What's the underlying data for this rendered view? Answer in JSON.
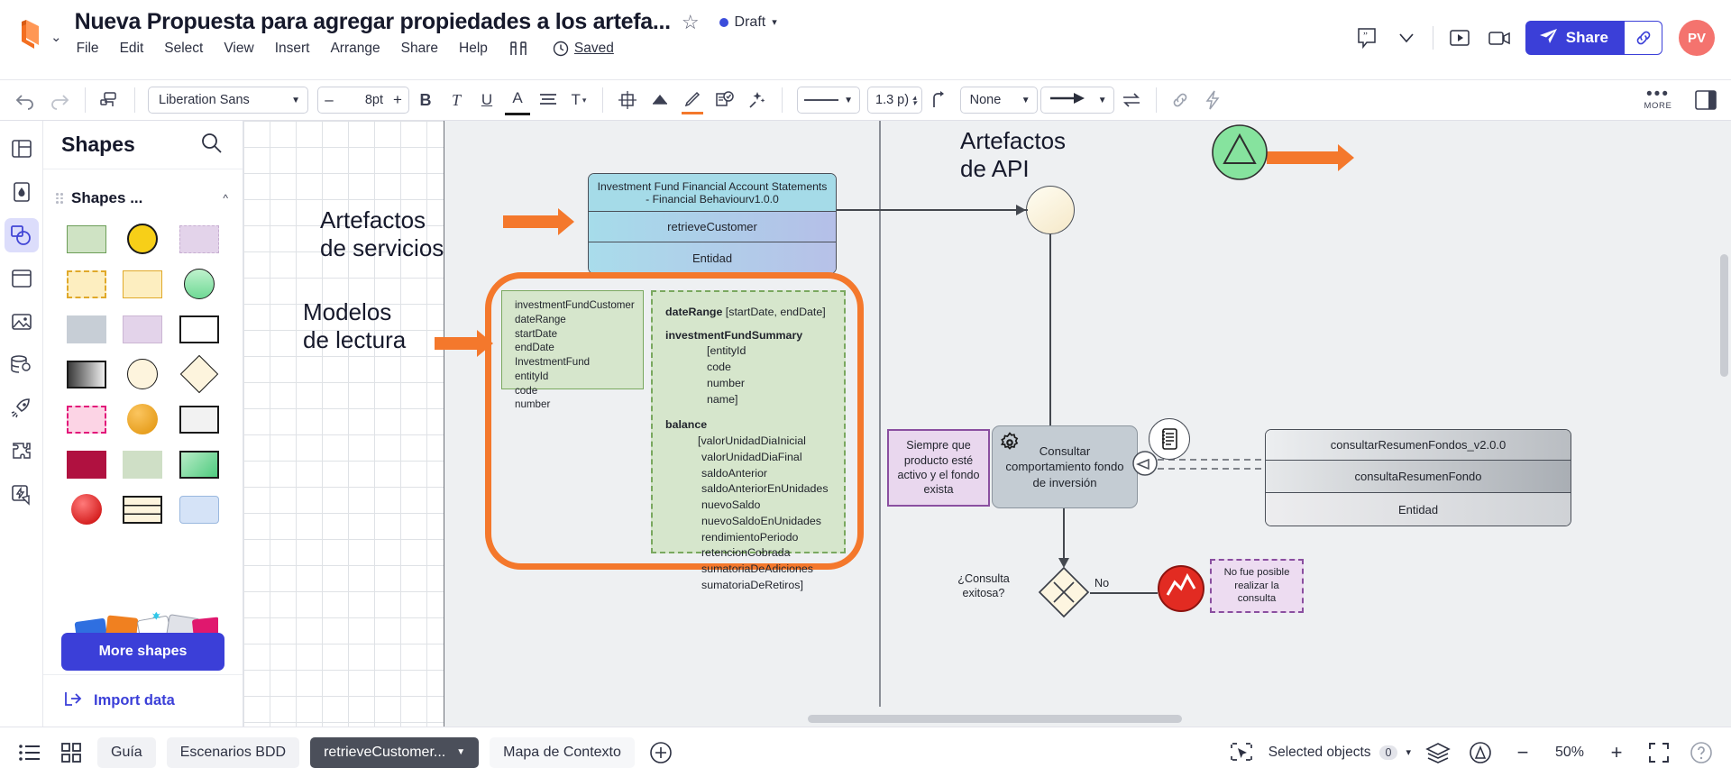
{
  "header": {
    "doc_title": "Nueva Propuesta para agregar propiedades a los artefa...",
    "star_icon": "star-outline-icon",
    "status_dot_color": "#3b4ddb",
    "status_label": "Draft",
    "status_caret": "▾",
    "menu": [
      "File",
      "Edit",
      "Select",
      "View",
      "Insert",
      "Arrange",
      "Share",
      "Help"
    ],
    "menu_extra_icon": "shapes-library-icon",
    "history_icon": "clock-icon",
    "saved_label": "Saved",
    "comment_icon": "comment-quote-icon",
    "chevron_icon": "chevron-down-icon",
    "present_icon": "present-icon",
    "video_icon": "video-camera-icon",
    "share_label": "Share",
    "share_icon": "paper-plane-icon",
    "link_icon": "link-icon",
    "avatar_initials": "PV",
    "avatar_color": "#f4736e",
    "accent_color": "#3b3fd8"
  },
  "toolbar": {
    "undo_icon": "undo-icon",
    "redo_icon": "redo-icon",
    "format_painter_icon": "format-painter-icon",
    "font_family": "Liberation Sans",
    "font_caret": "▼",
    "decrease_label": "–",
    "font_size": "8pt",
    "increase_label": "+",
    "bold_label": "B",
    "italic_label": "T",
    "underline_label": "U",
    "text_color_label": "A",
    "align_icon": "align-icon",
    "text_options_label": "T",
    "distribute_icon": "distribute-icon",
    "fill_icon": "fill-bucket-icon",
    "line-color_icon": "pen-icon",
    "notes_icon": "note-check-icon",
    "magic_icon": "magic-wand-icon",
    "line_style_caret": "▼",
    "line_weight": "1.3 p)",
    "connector_icon": "elbow-connector-icon",
    "line_start": "None",
    "line_start_caret": "▼",
    "line_end_icon": "arrow-end-icon",
    "line_end_caret": "▼",
    "swap_icon": "swap-ends-icon",
    "link_icon": "link-icon",
    "lightning_icon": "lightning-icon",
    "more_label": "MORE",
    "panel_toggle_icon": "right-panel-icon"
  },
  "rail": {
    "items": [
      {
        "name": "templates-icon",
        "active": false
      },
      {
        "name": "theme-icon",
        "active": false
      },
      {
        "name": "shapes-icon",
        "active": true
      },
      {
        "name": "frames-icon",
        "active": false
      },
      {
        "name": "image-icon",
        "active": false
      },
      {
        "name": "data-icon",
        "active": false
      },
      {
        "name": "rocket-icon",
        "active": false
      },
      {
        "name": "plugins-icon",
        "active": false
      },
      {
        "name": "automation-icon",
        "active": false
      }
    ]
  },
  "shapes_panel": {
    "title": "Shapes",
    "search_icon": "search-icon",
    "section_title": "Shapes ...",
    "collapse_caret": "^",
    "more_shapes_label": "More shapes",
    "import_label": "Import data",
    "import_icon": "import-icon",
    "swatches": [
      {
        "shape": "rect",
        "fill": "#cfe3c4",
        "stroke": "#6c9e58",
        "dashed": false
      },
      {
        "shape": "circle",
        "fill": "#f7cf18",
        "stroke": "#1a1a1a",
        "dashed": false
      },
      {
        "shape": "rect",
        "fill": "#e3d3ea",
        "stroke": "#c6aed1",
        "dashed": true
      },
      {
        "shape": "rect",
        "fill": "#fdeec0",
        "stroke": "#e0a92a",
        "dashed": true
      },
      {
        "shape": "rect",
        "fill": "#fdeec0",
        "stroke": "#e0a92a",
        "dashed": false
      },
      {
        "shape": "circle",
        "fill": "#8ce5a8",
        "stroke": "#1a1a1a",
        "dashed": false
      },
      {
        "shape": "rect",
        "fill": "#c7ced6",
        "stroke": "#c7ced6",
        "dashed": false
      },
      {
        "shape": "rect",
        "fill": "#e3d3ea",
        "stroke": "#cbb6d4",
        "dashed": false
      },
      {
        "shape": "rect",
        "fill": "#ffffff",
        "stroke": "#1a1a1a",
        "dashed": false
      },
      {
        "shape": "rect",
        "fill": "#8e8e8e",
        "stroke": "#1a1a1a",
        "dashed": false
      },
      {
        "shape": "circle",
        "fill": "#fdf4dd",
        "stroke": "#1a1a1a",
        "dashed": false
      },
      {
        "shape": "diamond",
        "fill": "#fdf4dd",
        "stroke": "#1a1a1a",
        "dashed": false
      },
      {
        "shape": "rect",
        "fill": "#fcd4e5",
        "stroke": "#e2187a",
        "dashed": true
      },
      {
        "shape": "circle",
        "fill": "#eea215",
        "stroke": "#eea215",
        "dashed": false
      },
      {
        "shape": "rect",
        "fill": "#f2f2f2",
        "stroke": "#1a1a1a",
        "dashed": false
      },
      {
        "shape": "rect",
        "fill": "#b01140",
        "stroke": "#b01140",
        "dashed": false
      },
      {
        "shape": "rect",
        "fill": "#cfdfc6",
        "stroke": "#cfdfc6",
        "dashed": false
      },
      {
        "shape": "rect",
        "fill": "#7ad89b",
        "stroke": "#1a1a1a",
        "dashed": false
      },
      {
        "shape": "circle",
        "fill": "#e01c1c",
        "stroke": "#e01c1c",
        "dashed": false
      },
      {
        "shape": "table",
        "fill": "#fdf4dd",
        "stroke": "#1a1a1a",
        "dashed": false
      },
      {
        "shape": "rect",
        "fill": "#d5e3f7",
        "stroke": "#9ab8df",
        "dashed": false
      }
    ]
  },
  "canvas": {
    "labels": [
      {
        "name": "label-artefactos-api",
        "text": "Artefactos\nde API"
      },
      {
        "name": "label-artefactos-servicios",
        "text": "Artefactos\nde servicios"
      },
      {
        "name": "label-modelos-lectura",
        "text": "Modelos\nde lectura"
      }
    ],
    "uml_service": {
      "header": "Investment  Fund Financial Account Statements - Financial Behaviourv1.0.0",
      "operation": "retrieveCustomer",
      "entity": "Entidad"
    },
    "uml_right": {
      "header": "consultarResumenFondos_v2.0.0",
      "operation": "consultaResumenFondo",
      "entity": "Entidad"
    },
    "model_left_lines": [
      "investmentFundCustomer",
      "dateRange",
      "startDate",
      "endDate",
      "InvestmentFund",
      "entityId",
      "code",
      "number"
    ],
    "model_right": {
      "line1_bold": "dateRange",
      "line1_rest": " [startDate, endDate]",
      "line2_bold": "investmentFundSummary",
      "line2_items": [
        "[entityId",
        "code",
        "number",
        "name]"
      ],
      "line3_bold": "balance",
      "line3_items": [
        "[valorUnidadDiaInicial",
        "valorUnidadDiaFinal",
        "saldoAnterior",
        "saldoAnteriorEnUnidades",
        "nuevoSaldo",
        "nuevoSaldoEnUnidades",
        "rendimientoPeriodo",
        "retencionCobrada",
        "sumatoriaDeAdiciones",
        "sumatoriaDeRetiros]"
      ]
    },
    "note_purple": "Siempre que producto esté activo y el fondo exista",
    "task_label": "Consultar comportamiento fondo de inversión",
    "task_gear_icon": "gear-icon",
    "doc_circle_icon": "document-list-icon",
    "gateway_question": "¿Consulta exitosa?",
    "gateway_no_label": "No",
    "error_note": "No fue posible realizar la consulta",
    "orange_color": "#f4782c"
  },
  "bottom": {
    "list_icon": "list-view-icon",
    "grid_icon": "grid-view-icon",
    "tabs": [
      {
        "label": "Guía",
        "active": false,
        "caret": ""
      },
      {
        "label": "Escenarios BDD",
        "active": false,
        "caret": ""
      },
      {
        "label": "retrieveCustomer...",
        "active": true,
        "caret": "▼"
      },
      {
        "label": "Mapa de Contexto",
        "active": false,
        "caret": ""
      }
    ],
    "add_tab_icon": "plus-circle-icon",
    "selected_objects_label": "Selected objects",
    "selected_objects_count": "0",
    "selected_caret": "▾",
    "select_icon": "cursor-select-icon",
    "layers_icon": "layers-icon",
    "accessibility_icon": "accessibility-icon",
    "zoom_out_label": "−",
    "zoom_value": "50%",
    "zoom_in_label": "+",
    "fit_icon": "fit-screen-icon",
    "help_icon": "help-circle-icon"
  }
}
